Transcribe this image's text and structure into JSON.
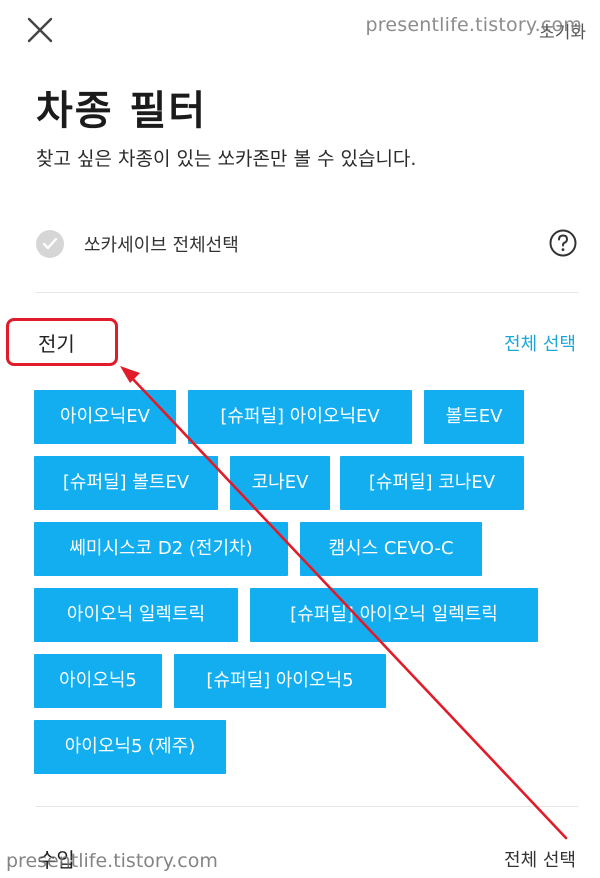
{
  "header": {
    "close_icon": "close-icon",
    "reset_label": "초기화",
    "watermark": "presentlife.tistory.com"
  },
  "page": {
    "title": "차종 필터",
    "subtitle": "찾고 싶은 차종이 있는 쏘카존만 볼 수 있습니다."
  },
  "socar_save": {
    "label": "쏘카세이브 전체선택",
    "checked": false,
    "help_icon": "help-circle-icon"
  },
  "sections": {
    "electric": {
      "title": "전기",
      "select_all": "전체 선택",
      "chips": [
        "아이오닉EV",
        "[슈퍼딜] 아이오닉EV",
        "볼트EV",
        "[슈퍼딜] 볼트EV",
        "코나EV",
        "[슈퍼딜] 코나EV",
        "쎄미시스코 D2 (전기차)",
        "캠시스 CEVO-C",
        "아이오닉 일렉트릭",
        "[슈퍼딜] 아이오닉 일렉트릭",
        "아이오닉5",
        "[슈퍼딜] 아이오닉5",
        "아이오닉5 (제주)"
      ]
    },
    "import": {
      "title": "수입",
      "select_all": "전체 선택"
    }
  },
  "footer": {
    "watermark": "presentlife.tistory.com"
  },
  "colors": {
    "chip": "#12aef0",
    "accent_link": "#1aa7d8",
    "annotation_red": "#e11c2a"
  }
}
